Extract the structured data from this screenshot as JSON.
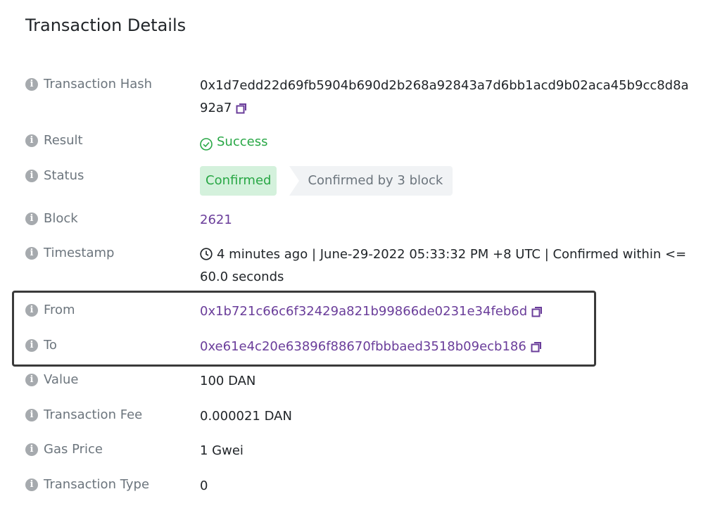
{
  "page_title": "Transaction Details",
  "fields": {
    "tx_hash": {
      "label": "Transaction Hash",
      "value": "0x1d7edd22d69fb5904b690d2b268a92843a7d6bb1acd9b02aca45b9cc8d8a92a7"
    },
    "result": {
      "label": "Result",
      "value": "Success"
    },
    "status": {
      "label": "Status",
      "badge": "Confirmed",
      "confirmations": "Confirmed by 3 block"
    },
    "block": {
      "label": "Block",
      "value": "2621"
    },
    "timestamp": {
      "label": "Timestamp",
      "value": "4 minutes ago | June-29-2022 05:33:32 PM +8 UTC | Confirmed within <= 60.0 seconds"
    },
    "from": {
      "label": "From",
      "value": "0x1b721c66c6f32429a821b99866de0231e34feb6d"
    },
    "to": {
      "label": "To",
      "value": "0xe61e4c20e63896f88670fbbbaed3518b09ecb186"
    },
    "value": {
      "label": "Value",
      "value": "100 DAN"
    },
    "fee": {
      "label": "Transaction Fee",
      "value": "0.000021 DAN"
    },
    "gas_price": {
      "label": "Gas Price",
      "value": "1 Gwei"
    },
    "tx_type": {
      "label": "Transaction Type",
      "value": "0"
    }
  },
  "colors": {
    "link": "#6a3d9a",
    "success": "#28a745",
    "label": "#6c757d",
    "badge_bg": "#d4f1dc"
  },
  "icons": {
    "info": "info-circle-icon",
    "copy": "copy-icon",
    "success": "check-circle-icon",
    "time": "clock-icon"
  }
}
